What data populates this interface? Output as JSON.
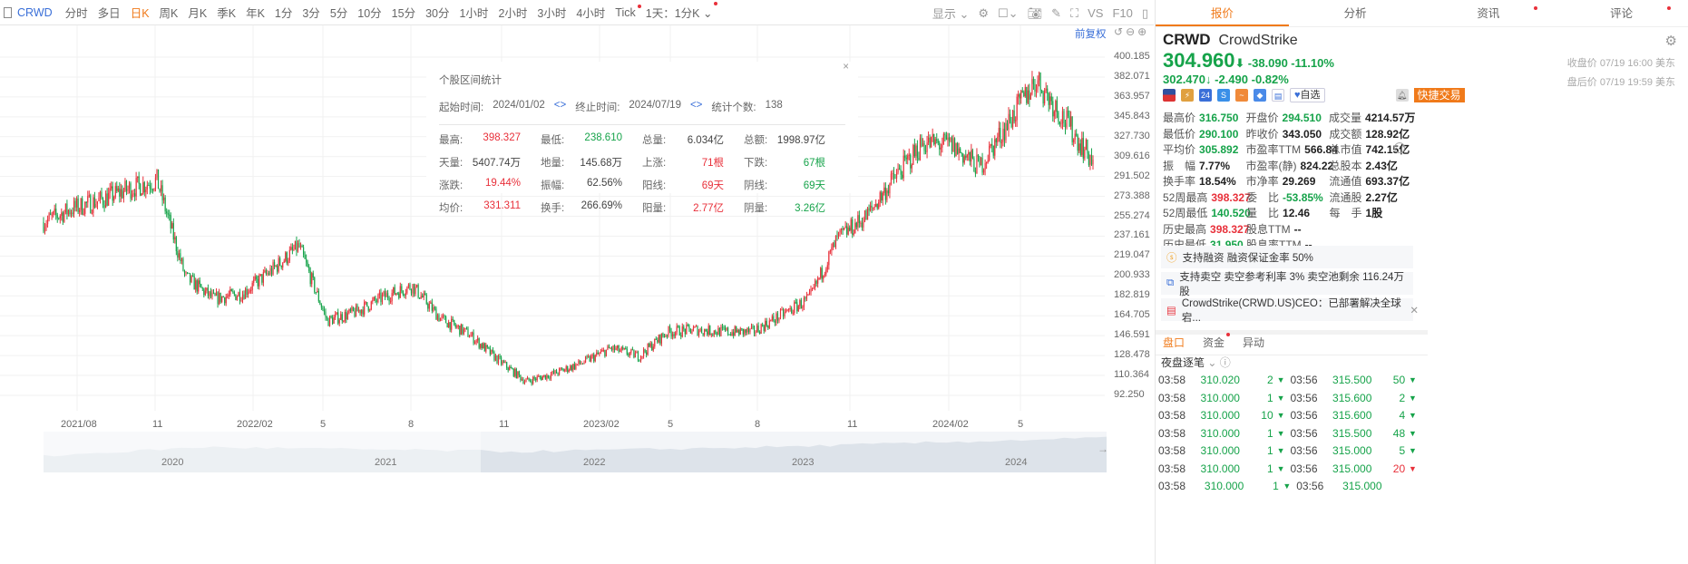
{
  "toolbar": {
    "symbol": "CRWD",
    "periods": [
      "分时",
      "多日",
      "日K",
      "周K",
      "月K",
      "季K",
      "年K",
      "1分",
      "3分",
      "5分",
      "10分",
      "15分",
      "30分",
      "1小时",
      "2小时",
      "3小时",
      "4小时",
      "Tick",
      "1天：1分K"
    ],
    "active": "日K",
    "display": "显示",
    "vs": "VS",
    "f10": "F10"
  },
  "chart": {
    "adjust": "前复权",
    "y_ticks": [
      "400.185",
      "382.071",
      "363.957",
      "345.843",
      "327.730",
      "309.616",
      "291.502",
      "273.388",
      "255.274",
      "237.161",
      "219.047",
      "200.933",
      "182.819",
      "164.705",
      "146.591",
      "128.478",
      "110.364",
      "92.250"
    ],
    "x_ticks": [
      "2021/08",
      "11",
      "2022/02",
      "5",
      "8",
      "11",
      "2023/02",
      "5",
      "8",
      "11",
      "2024/02",
      "5"
    ],
    "nav_ticks": [
      "2020",
      "2021",
      "2022",
      "2023",
      "2024"
    ],
    "colors": {
      "up": "#e8303a",
      "down": "#16a34a"
    }
  },
  "chart_data": {
    "type": "candlestick",
    "ylim": [
      92.25,
      400.185
    ],
    "x": [
      "2021/07",
      "2021/08",
      "2021/09",
      "2021/10",
      "2021/11",
      "2021/12",
      "2022/01",
      "2022/02",
      "2022/03",
      "2022/04",
      "2022/05",
      "2022/06",
      "2022/07",
      "2022/08",
      "2022/09",
      "2022/10",
      "2022/11",
      "2022/12",
      "2023/01",
      "2023/02",
      "2023/03",
      "2023/04",
      "2023/05",
      "2023/06",
      "2023/07",
      "2023/08",
      "2023/09",
      "2023/10",
      "2023/11",
      "2023/12",
      "2024/01",
      "2024/02",
      "2024/03",
      "2024/04",
      "2024/05",
      "2024/06",
      "2024/07",
      "2024/07/19"
    ],
    "close_approx": [
      250,
      262,
      270,
      280,
      288,
      200,
      180,
      185,
      205,
      228,
      160,
      168,
      182,
      192,
      162,
      148,
      125,
      105,
      112,
      122,
      135,
      128,
      150,
      152,
      150,
      150,
      165,
      180,
      235,
      255,
      290,
      322,
      320,
      300,
      340,
      380,
      343,
      304.96
    ]
  },
  "popup": {
    "title": "个股区间统计",
    "start_label": "起始时间:",
    "start": "2024/01/02",
    "end_label": "终止时间:",
    "end": "2024/07/19",
    "count_label": "统计个数:",
    "count": "138",
    "cells": [
      {
        "l": "最高:",
        "v": "398.327",
        "c": "red"
      },
      {
        "l": "最低:",
        "v": "238.610",
        "c": "green"
      },
      {
        "l": "总量:",
        "v": "6.034亿",
        "c": ""
      },
      {
        "l": "总额:",
        "v": "1998.97亿",
        "c": ""
      },
      {
        "l": "天量:",
        "v": "5407.74万",
        "c": ""
      },
      {
        "l": "地量:",
        "v": "145.68万",
        "c": ""
      },
      {
        "l": "上涨:",
        "v": "71根",
        "c": "red"
      },
      {
        "l": "下跌:",
        "v": "67根",
        "c": "green"
      },
      {
        "l": "涨跌:",
        "v": "19.44%",
        "c": "red"
      },
      {
        "l": "振幅:",
        "v": "62.56%",
        "c": ""
      },
      {
        "l": "阳线:",
        "v": "69天",
        "c": "red"
      },
      {
        "l": "阴线:",
        "v": "69天",
        "c": "green"
      },
      {
        "l": "均价:",
        "v": "331.311",
        "c": "red"
      },
      {
        "l": "换手:",
        "v": "266.69%",
        "c": ""
      },
      {
        "l": "阳量:",
        "v": "2.77亿",
        "c": "red"
      },
      {
        "l": "阴量:",
        "v": "3.26亿",
        "c": "green"
      }
    ]
  },
  "quote": {
    "tabs": [
      "报价",
      "分析",
      "资讯",
      "评论"
    ],
    "code": "CRWD",
    "name": "CrowdStrike",
    "price": "304.960",
    "change": "-38.090",
    "pct": "-11.10%",
    "close_meta": "收盘价 07/19 16:00 美东",
    "ah_price": "302.470",
    "ah_change": "-2.490",
    "ah_pct": "-0.82%",
    "ah_meta": "盘后价 07/19 19:59 美东",
    "watch": "自选",
    "trade": "快捷交易",
    "stats": [
      [
        {
          "l": "最高价",
          "v": "316.750",
          "c": "green"
        },
        {
          "l": "开盘价",
          "v": "294.510",
          "c": "green"
        },
        {
          "l": "成交量",
          "v": "4214.57万",
          "c": ""
        }
      ],
      [
        {
          "l": "最低价",
          "v": "290.100",
          "c": "green"
        },
        {
          "l": "昨收价",
          "v": "343.050",
          "c": ""
        },
        {
          "l": "成交额",
          "v": "128.92亿",
          "c": ""
        }
      ],
      [
        {
          "l": "平均价",
          "v": "305.892",
          "c": "green"
        },
        {
          "l": "市盈率TTM",
          "v": "566.84",
          "c": ""
        },
        {
          "l": "总市值",
          "v": "742.15亿",
          "c": ""
        }
      ],
      [
        {
          "l": "振　幅",
          "v": "7.77%",
          "c": ""
        },
        {
          "l": "市盈率(静)",
          "v": "824.22",
          "c": ""
        },
        {
          "l": "总股本",
          "v": "2.43亿",
          "c": ""
        }
      ],
      [
        {
          "l": "换手率",
          "v": "18.54%",
          "c": ""
        },
        {
          "l": "市净率",
          "v": "29.269",
          "c": ""
        },
        {
          "l": "流通值",
          "v": "693.37亿",
          "c": ""
        }
      ],
      [
        {
          "l": "52周最高",
          "v": "398.327",
          "c": "red"
        },
        {
          "l": "委　比",
          "v": "-53.85%",
          "c": "green"
        },
        {
          "l": "流通股",
          "v": "2.27亿",
          "c": ""
        }
      ],
      [
        {
          "l": "52周最低",
          "v": "140.520",
          "c": "green"
        },
        {
          "l": "量　比",
          "v": "12.46",
          "c": ""
        },
        {
          "l": "每　手",
          "v": "1股",
          "c": ""
        }
      ],
      [
        {
          "l": "历史最高",
          "v": "398.327",
          "c": "red"
        },
        {
          "l": "股息TTM",
          "v": "--",
          "c": ""
        }
      ],
      [
        {
          "l": "历史最低",
          "v": "31.950",
          "c": "green"
        },
        {
          "l": "股息率TTM",
          "v": "--",
          "c": ""
        }
      ]
    ],
    "info": [
      "支持融资 融资保证金率 50%",
      "支持卖空 卖空参考利率 3% 卖空池剩余 116.24万股",
      "CrowdStrike(CRWD.US)CEO：已部署解决全球宕..."
    ]
  },
  "panel": {
    "tabs": [
      "盘口",
      "资金",
      "异动"
    ],
    "ticks_title": "夜盘逐笔",
    "ticks": [
      [
        "03:58",
        "310.020",
        "2",
        "03:56",
        "315.500",
        "50",
        ""
      ],
      [
        "03:58",
        "310.000",
        "1",
        "03:56",
        "315.600",
        "2",
        ""
      ],
      [
        "03:58",
        "310.000",
        "10",
        "03:56",
        "315.600",
        "4",
        ""
      ],
      [
        "03:58",
        "310.000",
        "1",
        "03:56",
        "315.500",
        "48",
        ""
      ],
      [
        "03:58",
        "310.000",
        "1",
        "03:56",
        "315.000",
        "5",
        ""
      ],
      [
        "03:58",
        "310.000",
        "1",
        "03:56",
        "315.000",
        "20",
        "red"
      ],
      [
        "03:58",
        "310.000",
        "1",
        "03:56",
        "315.000",
        "",
        ""
      ]
    ]
  }
}
